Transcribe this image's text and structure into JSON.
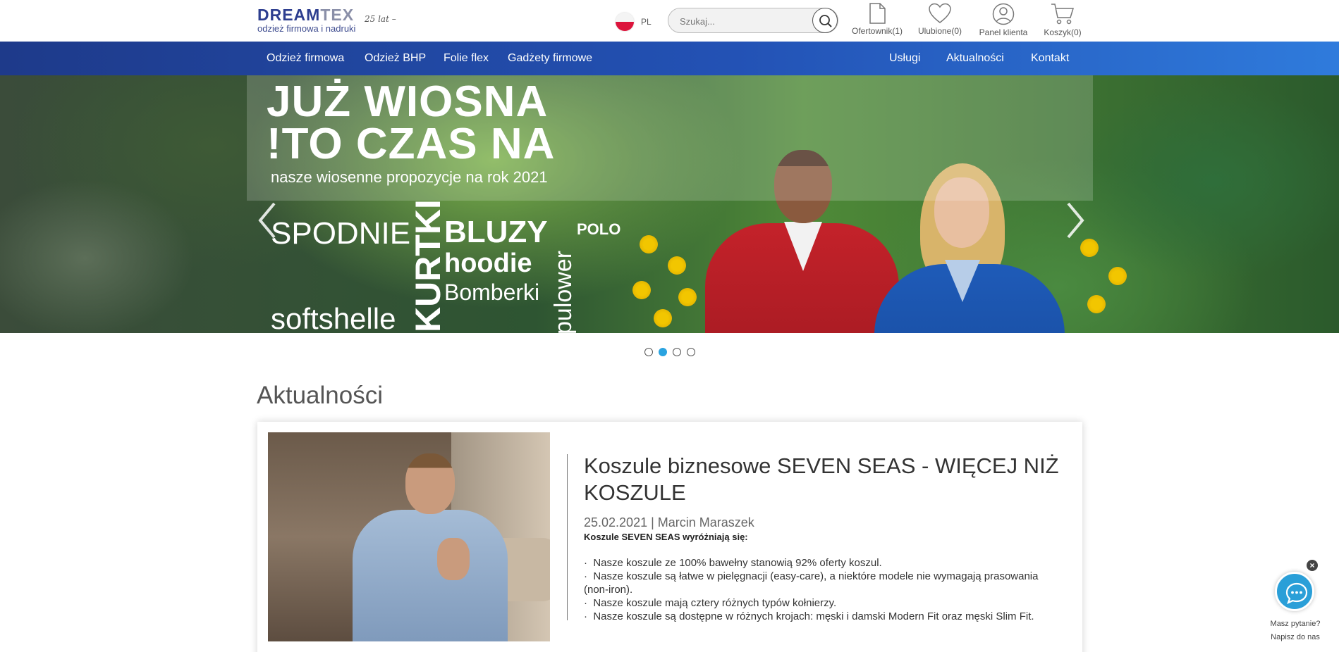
{
  "header": {
    "logo": {
      "main_a": "DREAM",
      "main_b": "TEX",
      "years": "25 lat –",
      "tagline": "odzież firmowa i nadruki"
    },
    "language": "PL",
    "search": {
      "placeholder": "Szukaj..."
    },
    "tools": [
      {
        "label": "Ofertownik(1)",
        "icon": "document-icon"
      },
      {
        "label": "Ulubione(0)",
        "icon": "heart-icon"
      },
      {
        "label": "Panel klienta",
        "icon": "user-icon"
      },
      {
        "label": "Koszyk(0)",
        "icon": "cart-icon"
      }
    ]
  },
  "nav": {
    "left": [
      "Odzież firmowa",
      "Odzież BHP",
      "Folie flex",
      "Gadżety firmowe"
    ],
    "right": [
      "Usługi",
      "Aktualności",
      "Kontakt"
    ]
  },
  "hero": {
    "headline_1": "JUŻ WIOSNA",
    "headline_2": "!TO CZAS NA",
    "subline": "nasze wiosenne propozycje na rok 2021",
    "words": {
      "spodnie": "SPODNIE",
      "kurtki": "KURTKI",
      "bluzy": "BLUZY",
      "hoodie": "hoodie",
      "bomberki": "Bomberki",
      "pulower": "pulower",
      "polo": "POLO",
      "softshelle": "softshelle"
    },
    "slide_count": 4,
    "active_slide": 2
  },
  "news": {
    "section_title": "Aktualności",
    "article": {
      "title": "Koszule biznesowe SEVEN SEAS - WIĘCEJ NIŻ KOSZULE",
      "meta": "25.02.2021 | Marcin Maraszek",
      "lead": "Koszule SEVEN SEAS wyróżniają się:",
      "bullets": [
        "Nasze koszule ze 100% bawełny stanowią 92% oferty koszul.",
        "Nasze koszule są łatwe w pielęgnacji (easy-care), a niektóre modele nie wymagają prasowania (non-iron).",
        "Nasze koszule mają cztery różnych typów kołnierzy.",
        "Nasze koszule są dostępne w różnych krojach: męski i damski Modern Fit oraz męski Slim Fit."
      ]
    }
  },
  "chat": {
    "line_1": "Masz pytanie?",
    "line_2": "Napisz do nas",
    "close": "×"
  },
  "colors": {
    "nav_start": "#1e3a8a",
    "nav_end": "#2f7bdc",
    "accent": "#2aa3e0",
    "chat": "#2a9fd8"
  }
}
